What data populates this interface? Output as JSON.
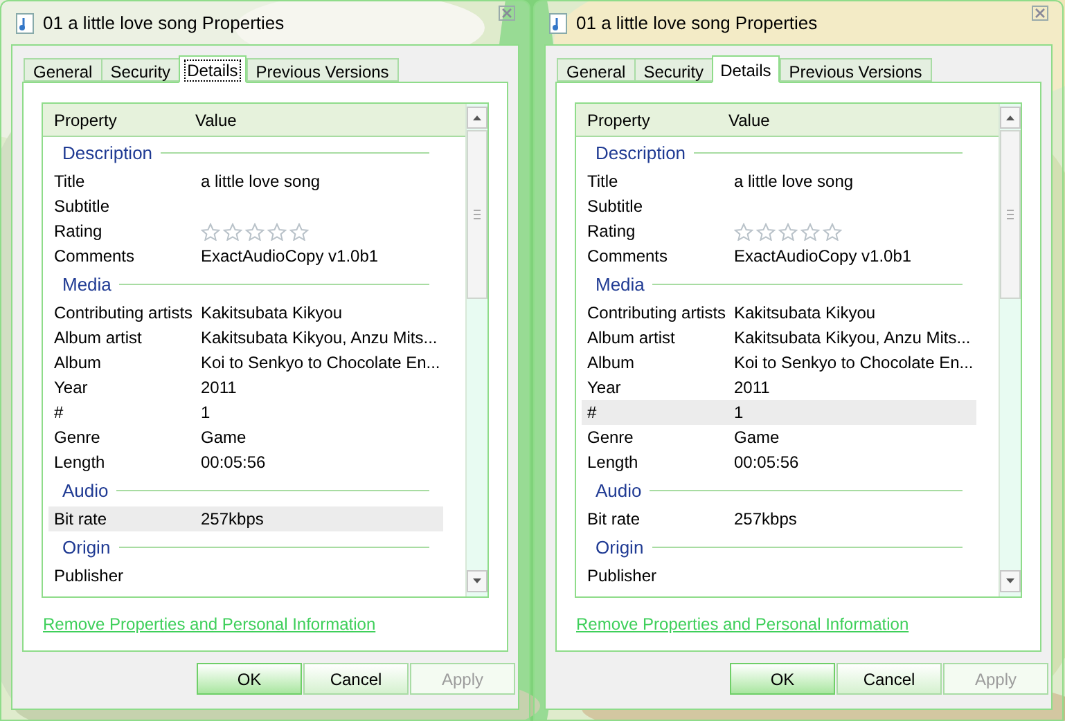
{
  "windows": [
    {
      "title": "01 a little love song Properties",
      "tabs": [
        {
          "label": "General",
          "selected": false
        },
        {
          "label": "Security",
          "selected": false
        },
        {
          "label": "Details",
          "selected": true,
          "focused": true
        },
        {
          "label": "Previous Versions",
          "selected": false
        }
      ],
      "columns": [
        "Property",
        "Value"
      ],
      "sections": [
        {
          "heading": "Description",
          "rows": [
            {
              "kind": "text",
              "label": "Title",
              "value": "a little love song",
              "selected": false
            },
            {
              "kind": "text",
              "label": "Subtitle",
              "selected": false
            },
            {
              "kind": "rating",
              "label": "Rating",
              "stars": 0,
              "selected": false
            },
            {
              "kind": "text",
              "label": "Comments",
              "value": "ExactAudioCopy v1.0b1",
              "selected": false
            }
          ]
        },
        {
          "heading": "Media",
          "rows": [
            {
              "kind": "text",
              "label": "Contributing artists",
              "value": "Kakitsubata Kikyou",
              "selected": false
            },
            {
              "kind": "text",
              "label": "Album artist",
              "value": "Kakitsubata Kikyou, Anzu Mits...",
              "selected": false
            },
            {
              "kind": "text",
              "label": "Album",
              "value": "Koi to Senkyo to Chocolate En...",
              "selected": false
            },
            {
              "kind": "text",
              "label": "Year",
              "value": "2011",
              "selected": false
            },
            {
              "kind": "text",
              "label": "#",
              "value": "1",
              "selected": false
            },
            {
              "kind": "text",
              "label": "Genre",
              "value": "Game",
              "selected": false
            },
            {
              "kind": "text",
              "label": "Length",
              "value": "00:05:56",
              "selected": false
            }
          ]
        },
        {
          "heading": "Audio",
          "rows": [
            {
              "kind": "text",
              "label": "Bit rate",
              "value": "257kbps",
              "selected": true
            }
          ]
        },
        {
          "heading": "Origin",
          "rows": [
            {
              "kind": "text",
              "label": "Publisher",
              "selected": false
            }
          ]
        }
      ],
      "link": "Remove Properties and Personal Information",
      "buttons": [
        {
          "label": "OK",
          "default": true,
          "disabled": false
        },
        {
          "label": "Cancel",
          "default": false,
          "disabled": false
        },
        {
          "label": "Apply",
          "default": false,
          "disabled": true
        }
      ]
    },
    {
      "title": "01 a little love song Properties",
      "tabs": [
        {
          "label": "General",
          "selected": false
        },
        {
          "label": "Security",
          "selected": false
        },
        {
          "label": "Details",
          "selected": true,
          "focused": false
        },
        {
          "label": "Previous Versions",
          "selected": false
        }
      ],
      "columns": [
        "Property",
        "Value"
      ],
      "sections": [
        {
          "heading": "Description",
          "rows": [
            {
              "kind": "text",
              "label": "Title",
              "value": "a little love song",
              "selected": false
            },
            {
              "kind": "text",
              "label": "Subtitle",
              "selected": false
            },
            {
              "kind": "rating",
              "label": "Rating",
              "stars": 0,
              "selected": false
            },
            {
              "kind": "text",
              "label": "Comments",
              "value": "ExactAudioCopy v1.0b1",
              "selected": false
            }
          ]
        },
        {
          "heading": "Media",
          "rows": [
            {
              "kind": "text",
              "label": "Contributing artists",
              "value": "Kakitsubata Kikyou",
              "selected": false
            },
            {
              "kind": "text",
              "label": "Album artist",
              "value": "Kakitsubata Kikyou, Anzu Mits...",
              "selected": false
            },
            {
              "kind": "text",
              "label": "Album",
              "value": "Koi to Senkyo to Chocolate En...",
              "selected": false
            },
            {
              "kind": "text",
              "label": "Year",
              "value": "2011",
              "selected": false
            },
            {
              "kind": "text",
              "label": "#",
              "value": "1",
              "selected": true
            },
            {
              "kind": "text",
              "label": "Genre",
              "value": "Game",
              "selected": false
            },
            {
              "kind": "text",
              "label": "Length",
              "value": "00:05:56",
              "selected": false
            }
          ]
        },
        {
          "heading": "Audio",
          "rows": [
            {
              "kind": "text",
              "label": "Bit rate",
              "value": "257kbps",
              "selected": false
            }
          ]
        },
        {
          "heading": "Origin",
          "rows": [
            {
              "kind": "text",
              "label": "Publisher",
              "selected": false
            }
          ]
        }
      ],
      "link": "Remove Properties and Personal Information",
      "buttons": [
        {
          "label": "OK",
          "default": true,
          "disabled": false
        },
        {
          "label": "Cancel",
          "default": false,
          "disabled": false
        },
        {
          "label": "Apply",
          "default": false,
          "disabled": true
        }
      ]
    }
  ]
}
